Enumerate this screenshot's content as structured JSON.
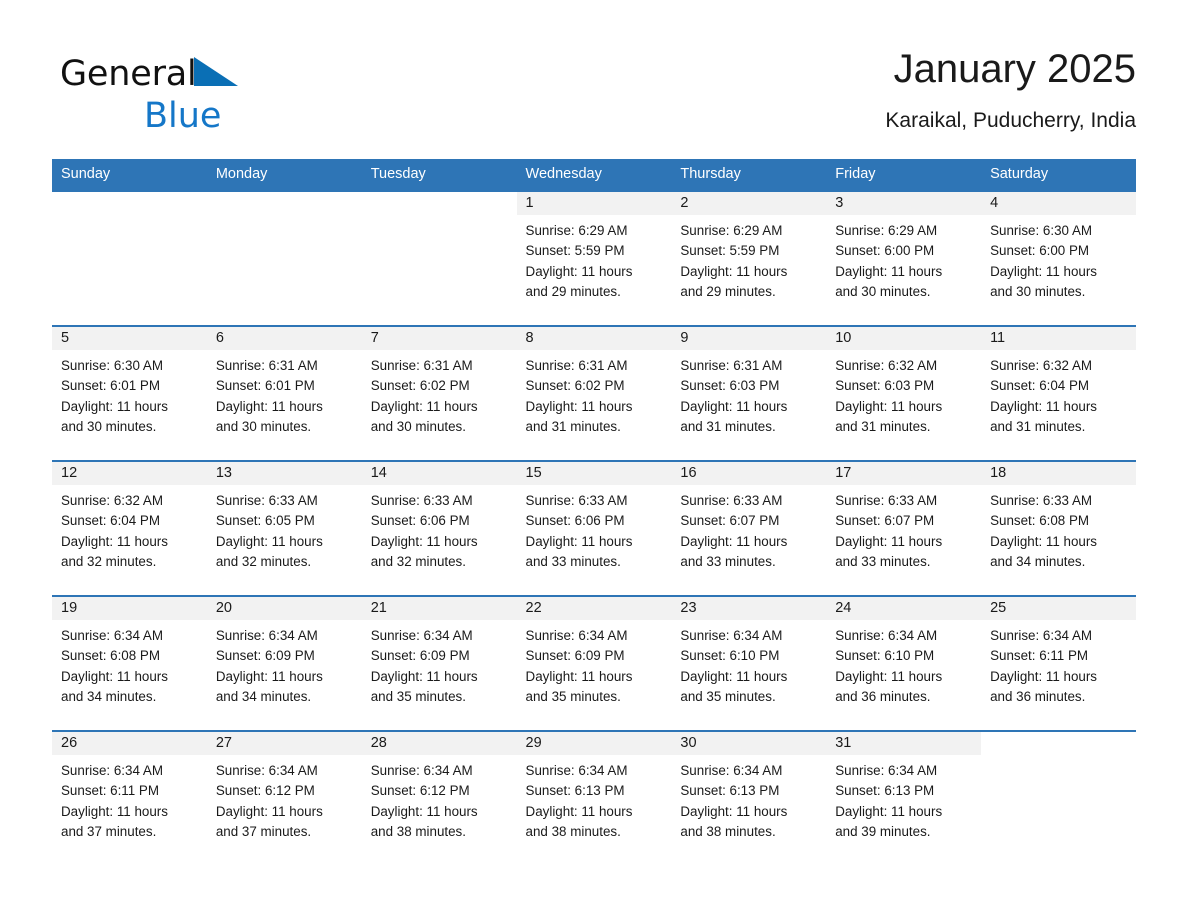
{
  "brand": {
    "name_part1": "General",
    "name_part2": "Blue",
    "triangle_color": "#0a6fb5",
    "blue_color": "#1577c8"
  },
  "header": {
    "title": "January 2025",
    "subtitle": "Karaikal, Puducherry, India"
  },
  "theme": {
    "header_blue": "#2e75b6",
    "daynum_band": "#f2f2f2",
    "page_background": "#ffffff"
  },
  "weekday_headers": [
    "Sunday",
    "Monday",
    "Tuesday",
    "Wednesday",
    "Thursday",
    "Friday",
    "Saturday"
  ],
  "weeks": [
    [
      {
        "day": "",
        "sunrise": "",
        "sunset": "",
        "daylight1": "",
        "daylight2": ""
      },
      {
        "day": "",
        "sunrise": "",
        "sunset": "",
        "daylight1": "",
        "daylight2": ""
      },
      {
        "day": "",
        "sunrise": "",
        "sunset": "",
        "daylight1": "",
        "daylight2": ""
      },
      {
        "day": "1",
        "sunrise": "Sunrise: 6:29 AM",
        "sunset": "Sunset: 5:59 PM",
        "daylight1": "Daylight: 11 hours",
        "daylight2": "and 29 minutes."
      },
      {
        "day": "2",
        "sunrise": "Sunrise: 6:29 AM",
        "sunset": "Sunset: 5:59 PM",
        "daylight1": "Daylight: 11 hours",
        "daylight2": "and 29 minutes."
      },
      {
        "day": "3",
        "sunrise": "Sunrise: 6:29 AM",
        "sunset": "Sunset: 6:00 PM",
        "daylight1": "Daylight: 11 hours",
        "daylight2": "and 30 minutes."
      },
      {
        "day": "4",
        "sunrise": "Sunrise: 6:30 AM",
        "sunset": "Sunset: 6:00 PM",
        "daylight1": "Daylight: 11 hours",
        "daylight2": "and 30 minutes."
      }
    ],
    [
      {
        "day": "5",
        "sunrise": "Sunrise: 6:30 AM",
        "sunset": "Sunset: 6:01 PM",
        "daylight1": "Daylight: 11 hours",
        "daylight2": "and 30 minutes."
      },
      {
        "day": "6",
        "sunrise": "Sunrise: 6:31 AM",
        "sunset": "Sunset: 6:01 PM",
        "daylight1": "Daylight: 11 hours",
        "daylight2": "and 30 minutes."
      },
      {
        "day": "7",
        "sunrise": "Sunrise: 6:31 AM",
        "sunset": "Sunset: 6:02 PM",
        "daylight1": "Daylight: 11 hours",
        "daylight2": "and 30 minutes."
      },
      {
        "day": "8",
        "sunrise": "Sunrise: 6:31 AM",
        "sunset": "Sunset: 6:02 PM",
        "daylight1": "Daylight: 11 hours",
        "daylight2": "and 31 minutes."
      },
      {
        "day": "9",
        "sunrise": "Sunrise: 6:31 AM",
        "sunset": "Sunset: 6:03 PM",
        "daylight1": "Daylight: 11 hours",
        "daylight2": "and 31 minutes."
      },
      {
        "day": "10",
        "sunrise": "Sunrise: 6:32 AM",
        "sunset": "Sunset: 6:03 PM",
        "daylight1": "Daylight: 11 hours",
        "daylight2": "and 31 minutes."
      },
      {
        "day": "11",
        "sunrise": "Sunrise: 6:32 AM",
        "sunset": "Sunset: 6:04 PM",
        "daylight1": "Daylight: 11 hours",
        "daylight2": "and 31 minutes."
      }
    ],
    [
      {
        "day": "12",
        "sunrise": "Sunrise: 6:32 AM",
        "sunset": "Sunset: 6:04 PM",
        "daylight1": "Daylight: 11 hours",
        "daylight2": "and 32 minutes."
      },
      {
        "day": "13",
        "sunrise": "Sunrise: 6:33 AM",
        "sunset": "Sunset: 6:05 PM",
        "daylight1": "Daylight: 11 hours",
        "daylight2": "and 32 minutes."
      },
      {
        "day": "14",
        "sunrise": "Sunrise: 6:33 AM",
        "sunset": "Sunset: 6:06 PM",
        "daylight1": "Daylight: 11 hours",
        "daylight2": "and 32 minutes."
      },
      {
        "day": "15",
        "sunrise": "Sunrise: 6:33 AM",
        "sunset": "Sunset: 6:06 PM",
        "daylight1": "Daylight: 11 hours",
        "daylight2": "and 33 minutes."
      },
      {
        "day": "16",
        "sunrise": "Sunrise: 6:33 AM",
        "sunset": "Sunset: 6:07 PM",
        "daylight1": "Daylight: 11 hours",
        "daylight2": "and 33 minutes."
      },
      {
        "day": "17",
        "sunrise": "Sunrise: 6:33 AM",
        "sunset": "Sunset: 6:07 PM",
        "daylight1": "Daylight: 11 hours",
        "daylight2": "and 33 minutes."
      },
      {
        "day": "18",
        "sunrise": "Sunrise: 6:33 AM",
        "sunset": "Sunset: 6:08 PM",
        "daylight1": "Daylight: 11 hours",
        "daylight2": "and 34 minutes."
      }
    ],
    [
      {
        "day": "19",
        "sunrise": "Sunrise: 6:34 AM",
        "sunset": "Sunset: 6:08 PM",
        "daylight1": "Daylight: 11 hours",
        "daylight2": "and 34 minutes."
      },
      {
        "day": "20",
        "sunrise": "Sunrise: 6:34 AM",
        "sunset": "Sunset: 6:09 PM",
        "daylight1": "Daylight: 11 hours",
        "daylight2": "and 34 minutes."
      },
      {
        "day": "21",
        "sunrise": "Sunrise: 6:34 AM",
        "sunset": "Sunset: 6:09 PM",
        "daylight1": "Daylight: 11 hours",
        "daylight2": "and 35 minutes."
      },
      {
        "day": "22",
        "sunrise": "Sunrise: 6:34 AM",
        "sunset": "Sunset: 6:09 PM",
        "daylight1": "Daylight: 11 hours",
        "daylight2": "and 35 minutes."
      },
      {
        "day": "23",
        "sunrise": "Sunrise: 6:34 AM",
        "sunset": "Sunset: 6:10 PM",
        "daylight1": "Daylight: 11 hours",
        "daylight2": "and 35 minutes."
      },
      {
        "day": "24",
        "sunrise": "Sunrise: 6:34 AM",
        "sunset": "Sunset: 6:10 PM",
        "daylight1": "Daylight: 11 hours",
        "daylight2": "and 36 minutes."
      },
      {
        "day": "25",
        "sunrise": "Sunrise: 6:34 AM",
        "sunset": "Sunset: 6:11 PM",
        "daylight1": "Daylight: 11 hours",
        "daylight2": "and 36 minutes."
      }
    ],
    [
      {
        "day": "26",
        "sunrise": "Sunrise: 6:34 AM",
        "sunset": "Sunset: 6:11 PM",
        "daylight1": "Daylight: 11 hours",
        "daylight2": "and 37 minutes."
      },
      {
        "day": "27",
        "sunrise": "Sunrise: 6:34 AM",
        "sunset": "Sunset: 6:12 PM",
        "daylight1": "Daylight: 11 hours",
        "daylight2": "and 37 minutes."
      },
      {
        "day": "28",
        "sunrise": "Sunrise: 6:34 AM",
        "sunset": "Sunset: 6:12 PM",
        "daylight1": "Daylight: 11 hours",
        "daylight2": "and 38 minutes."
      },
      {
        "day": "29",
        "sunrise": "Sunrise: 6:34 AM",
        "sunset": "Sunset: 6:13 PM",
        "daylight1": "Daylight: 11 hours",
        "daylight2": "and 38 minutes."
      },
      {
        "day": "30",
        "sunrise": "Sunrise: 6:34 AM",
        "sunset": "Sunset: 6:13 PM",
        "daylight1": "Daylight: 11 hours",
        "daylight2": "and 38 minutes."
      },
      {
        "day": "31",
        "sunrise": "Sunrise: 6:34 AM",
        "sunset": "Sunset: 6:13 PM",
        "daylight1": "Daylight: 11 hours",
        "daylight2": "and 39 minutes."
      },
      {
        "day": "",
        "sunrise": "",
        "sunset": "",
        "daylight1": "",
        "daylight2": ""
      }
    ]
  ]
}
